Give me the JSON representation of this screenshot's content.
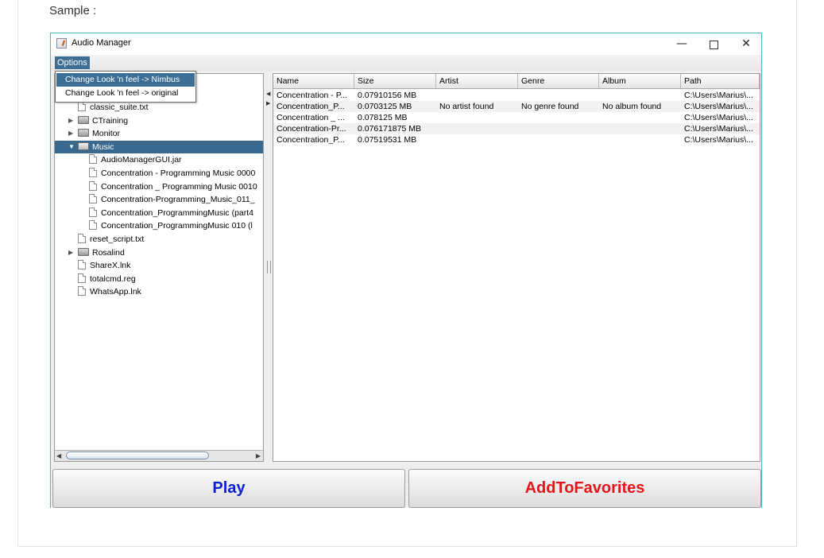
{
  "page": {
    "sample_label": "Sample :"
  },
  "window": {
    "title": "Audio Manager",
    "controls": {
      "minimize": "—",
      "close": "✕"
    }
  },
  "menubar": {
    "options_label": "Options"
  },
  "menu_popup": {
    "items": [
      {
        "label": "Change Look 'n feel -> Nimbus"
      },
      {
        "label": "Change Look 'n feel -> original"
      }
    ]
  },
  "tree": {
    "items": [
      {
        "label": "classic_suite.txt",
        "type": "file"
      },
      {
        "label": "CTraining",
        "type": "folder",
        "expander": "▶"
      },
      {
        "label": "Monitor",
        "type": "folder",
        "expander": "▶"
      },
      {
        "label": "Music",
        "type": "folder-open",
        "expander": "▼"
      },
      {
        "label": "AudioManagerGUI.jar",
        "type": "file"
      },
      {
        "label": "Concentration - Programming Music 0000",
        "type": "file"
      },
      {
        "label": "Concentration _ Programming Music 0010",
        "type": "file"
      },
      {
        "label": "Concentration-Programming_Music_011_",
        "type": "file"
      },
      {
        "label": "Concentration_ProgrammingMusic (part4",
        "type": "file"
      },
      {
        "label": "Concentration_ProgrammingMusic 010 (l",
        "type": "file"
      },
      {
        "label": "reset_script.txt",
        "type": "file"
      },
      {
        "label": "Rosalind",
        "type": "folder",
        "expander": "▶"
      },
      {
        "label": "ShareX.lnk",
        "type": "file"
      },
      {
        "label": "totalcmd.reg",
        "type": "file"
      },
      {
        "label": "WhatsApp.lnk",
        "type": "file"
      }
    ],
    "selected": "Music",
    "scroll_left": "◀",
    "scroll_right": "▶"
  },
  "divider": {
    "left_arrow": "◀",
    "right_arrow": "▶"
  },
  "table": {
    "columns": [
      "Name",
      "Size",
      "Artist",
      "Genre",
      "Album",
      "Path"
    ],
    "rows": [
      [
        "Concentration - P...",
        "0.07910156 MB",
        "",
        "",
        "",
        "C:\\Users\\Marius\\..."
      ],
      [
        "Concentration_P...",
        "0.0703125 MB",
        "No artist found",
        "No genre found",
        "No album found",
        "C:\\Users\\Marius\\..."
      ],
      [
        "Concentration _ ...",
        "0.078125 MB",
        "",
        "",
        "",
        "C:\\Users\\Marius\\..."
      ],
      [
        "Concentration-Pr...",
        "0.076171875 MB",
        "",
        "",
        "",
        "C:\\Users\\Marius\\..."
      ],
      [
        "Concentration_P...",
        "0.07519531 MB",
        "",
        "",
        "",
        "C:\\Users\\Marius\\..."
      ]
    ]
  },
  "buttons": {
    "play": "Play",
    "favorites": "AddToFavorites"
  },
  "colors": {
    "play_text": "#0b1fd4",
    "favorites_text": "#e3141a",
    "selection": "#39698f",
    "window_border": "#43b2cc"
  }
}
